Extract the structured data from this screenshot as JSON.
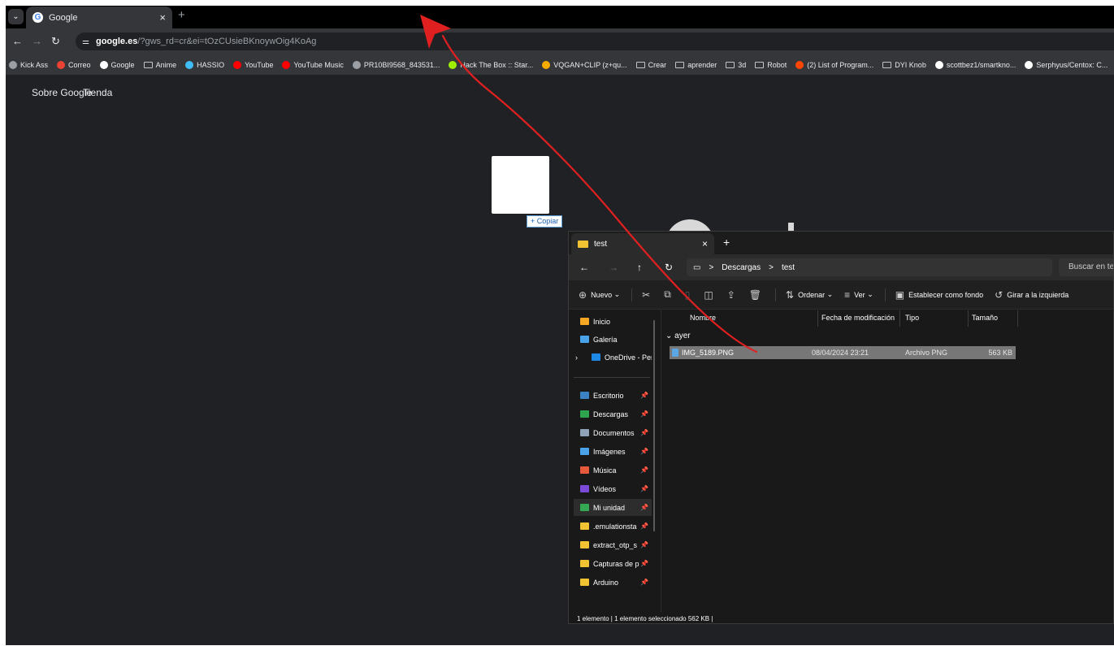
{
  "browser": {
    "tab_title": "Google",
    "tab_close": "×",
    "tab_new": "+",
    "tab_menu": "⌄",
    "url_host": "google.es",
    "url_path": "/?gws_rd=cr&ei=tOzCUsieBKnoywOig4KoAg",
    "bookmarks": [
      {
        "label": "Kick Ass",
        "icon": "globe-icon",
        "color": "#9aa0a6"
      },
      {
        "label": "Correo",
        "icon": "gmail-icon",
        "color": "#ea4335"
      },
      {
        "label": "Google",
        "icon": "google-icon",
        "color": "#ffffff"
      },
      {
        "label": "Anime",
        "icon": "folder-icon",
        "color": ""
      },
      {
        "label": "HASSIO",
        "icon": "home-assistant-icon",
        "color": "#41bdf5"
      },
      {
        "label": "YouTube",
        "icon": "youtube-icon",
        "color": "#ff0000"
      },
      {
        "label": "YouTube Music",
        "icon": "youtube-music-icon",
        "color": "#ff0000"
      },
      {
        "label": "PR10BI9568_843531...",
        "icon": "globe-icon",
        "color": "#9aa0a6"
      },
      {
        "label": "Hack The Box :: Star...",
        "icon": "hackthebox-icon",
        "color": "#9fef00"
      },
      {
        "label": "VQGAN+CLIP (z+qu...",
        "icon": "colab-icon",
        "color": "#f9ab00"
      },
      {
        "label": "Crear",
        "icon": "folder-icon",
        "color": ""
      },
      {
        "label": "aprender",
        "icon": "folder-icon",
        "color": ""
      },
      {
        "label": "3d",
        "icon": "folder-icon",
        "color": ""
      },
      {
        "label": "Robot",
        "icon": "folder-icon",
        "color": ""
      },
      {
        "label": "(2) List of Program...",
        "icon": "reddit-icon",
        "color": "#ff4500"
      },
      {
        "label": "DYI Knob",
        "icon": "folder-icon",
        "color": ""
      },
      {
        "label": "scottbez1/smartkno...",
        "icon": "github-icon",
        "color": "#ffffff"
      },
      {
        "label": "Serphyus/Centox: C...",
        "icon": "github-icon",
        "color": "#ffffff"
      }
    ]
  },
  "page": {
    "links": [
      "Sobre Google",
      "Tienda"
    ],
    "copy_tooltip": "+ Copiar"
  },
  "explorer": {
    "tab_title": "test",
    "tab_close": "×",
    "tab_new": "+",
    "path": [
      "Descargas",
      "test"
    ],
    "path_sep": ">",
    "search_placeholder": "Buscar en test",
    "commands": {
      "new": "Nuevo",
      "sort": "Ordenar",
      "view": "Ver",
      "set_background": "Establecer como fondo",
      "rotate_left": "Girar a la izquierda"
    },
    "nav_items": [
      {
        "label": "Inicio",
        "color": "#f5a623",
        "pinned": false
      },
      {
        "label": "Galería",
        "color": "#4aa3e8",
        "pinned": false
      },
      {
        "label": "OneDrive - Perso",
        "color": "#1e88e5",
        "pinned": false
      },
      {
        "label": "Escritorio",
        "color": "#3b82c4",
        "pinned": true
      },
      {
        "label": "Descargas",
        "color": "#2ea44f",
        "pinned": true
      },
      {
        "label": "Documentos",
        "color": "#8fa3b8",
        "pinned": true
      },
      {
        "label": "Imágenes",
        "color": "#4aa3e8",
        "pinned": true
      },
      {
        "label": "Música",
        "color": "#e65a3c",
        "pinned": true
      },
      {
        "label": "Vídeos",
        "color": "#7b4ad9",
        "pinned": true
      },
      {
        "label": "Mi unidad",
        "color": "#34a853",
        "pinned": true
      },
      {
        "label": ".emulationsta",
        "color": "#f1c232",
        "pinned": true
      },
      {
        "label": "extract_otp_s",
        "color": "#f1c232",
        "pinned": true
      },
      {
        "label": "Capturas de p",
        "color": "#f1c232",
        "pinned": true
      },
      {
        "label": "Arduino",
        "color": "#f1c232",
        "pinned": true
      }
    ],
    "columns": [
      "Nombre",
      "Fecha de modificación",
      "Tipo",
      "Tamaño"
    ],
    "group": "ayer",
    "files": [
      {
        "name": "IMG_5189.PNG",
        "date": "08/04/2024 23:21",
        "type": "Archivo PNG",
        "size": "563 KB"
      }
    ],
    "status": "1 elemento  |  1 elemento seleccionado  562 KB  |"
  },
  "annotation": {
    "arrow_color": "#e02020"
  }
}
